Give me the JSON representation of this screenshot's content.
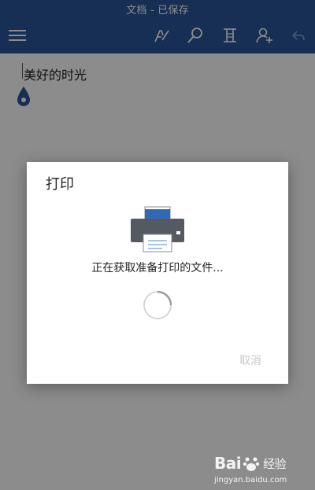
{
  "statusbar": {
    "title": "文档 - 已保存"
  },
  "toolbar": {
    "icons": [
      "menu-icon",
      "pen-icon",
      "search-icon",
      "read-mode-icon",
      "share-icon",
      "undo-icon"
    ],
    "background": "#2b579a"
  },
  "document": {
    "text": "美好的时光"
  },
  "dialog": {
    "title": "打印",
    "status": "正在获取准备打印的文件...",
    "cancel_label": "取消"
  },
  "watermark": {
    "logo": "Bai",
    "logo_suffix": "经验",
    "url": "jingyan.baidu.com"
  }
}
